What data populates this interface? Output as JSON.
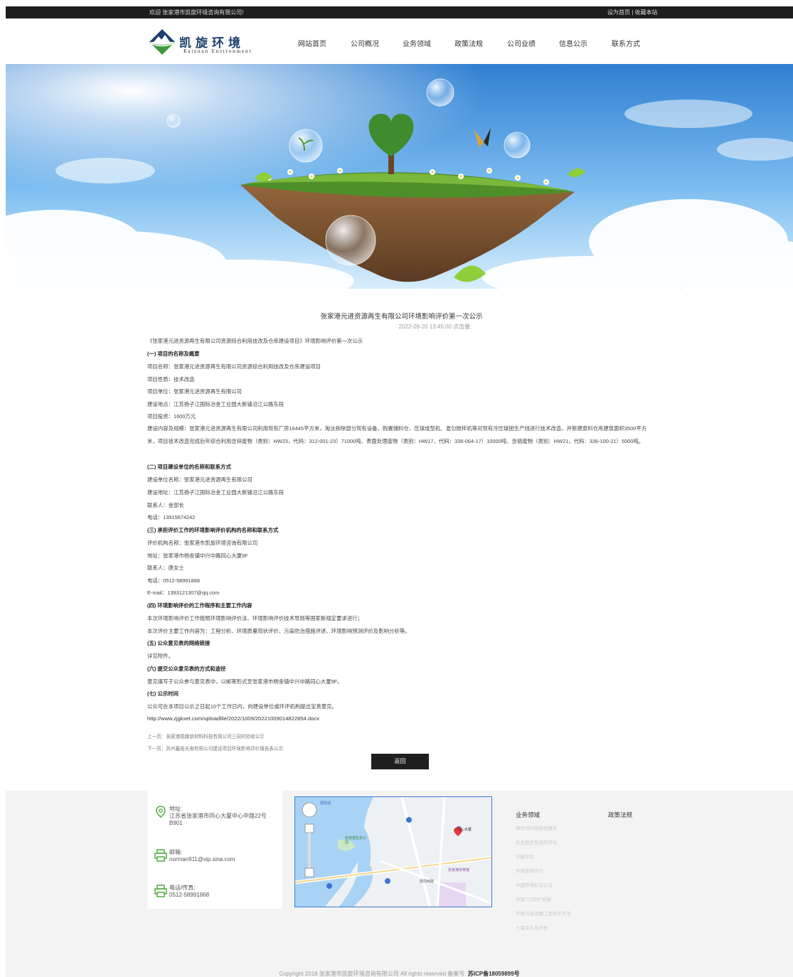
{
  "topbar": {
    "welcome": "欢迎 张家港市凯旋环境咨询有限公司!",
    "set_home": "设为首页",
    "separator": "|",
    "bookmark": "收藏本站"
  },
  "logo": {
    "name_cn": "凯旋环境",
    "name_en": "Kaixuan Environment"
  },
  "nav": [
    "网站首页",
    "公司概况",
    "业务领域",
    "政策法规",
    "公司业绩",
    "信息公示",
    "联系方式"
  ],
  "article": {
    "title": "张家港元进资源再生有限公司环境影响评价第一次公示",
    "meta": "2022-09-20 13:45:00 点击量:",
    "intro": "《张家港元进资源再生有限公司资源综合利用技改及仓库建设项目》环境影响评价第一次公示",
    "h1": "(一) 项目的名称及概要",
    "p_name": "项目名称：张家港元进资源再生有限公司资源综合利用技改及仓库建设项目",
    "p_nature": "项目性质：技术改造",
    "p_unit": "项目单位：张家港元进资源再生有限公司",
    "p_site": "建设地点：江苏扬子江国际冶金工业园大新镇沿江公路东段",
    "p_invest": "项目投资：1600万元",
    "p_scale": "建设内容及规模：张家港元进资源再生有限公司利用现有厂房16445平方米，淘汰拆除部分现有设备，购置储料仓、压球成型机、混匀搅拌机等对现有冷压球团生产线进行技术改造，并新建原料仓库建筑面积3500平方米，项目技术改造完成后年综合利用含锌废物（类别：HW23，代码：312-001-23）71000吨、表面处理废物（类别：HW17，代码：336-064-17）10000吨、含铬废物（类别：HW21，代码：336-100-21）5000吨。",
    "h2": "(二) 项目建设单位的名称和联系方式",
    "b_name": "建设单位名称：张家港元进资源再生有限公司",
    "b_addr": "建设地址：江苏扬子江国际冶金工业园大新镇沿江公路东段",
    "b_contact": "联系人：金部长",
    "b_tel": "电话：13915674242",
    "h3": "(三) 承担评价工作的环境影响评价机构的名称和联系方式",
    "e_name": "评价机构名称：张家港市凯旋环境咨询有限公司",
    "e_addr": "地址：张家港市杨舍镇中兴中路同心大厦9F",
    "e_contact": "联系人：唐女士",
    "e_tel": "电话：0512-58991868",
    "e_mail": "E-mail：1393121307@qq.com",
    "h4": "(四) 环境影响评价的工作程序和主要工作内容",
    "w1": "本次环境影响评价工作按照环境影响评价法、环境影响评价技术导则等国家新规定要求进行；",
    "w2": "本次评价主要工作内容为：工程分析、环境质量现状评价、污染防治措施评述、环境影响预测评价及影响分析等。",
    "h5": "(五) 公众意见表的网络链接",
    "link_text": "详见附件。",
    "h6": "(六) 提交公众意见表的方式和途径",
    "way": "意见填写于公众参与意见表中，以邮寄形式至张家港市杨舍镇中兴中路同心大厦9F。",
    "h7": "(七) 公示时间",
    "time": "公众可在本项目公示之日起10个工作日内，向建设单位或环评机构提出宝贵意见。",
    "url": "http://www.zjgkxet.com/uploadfile/2022/1009/20221009014822854.docx",
    "prev": "上一页：张家港德康新材料科技有限公司三同时验收公示",
    "next": "下一页：苏州鑫裕光电有限公司建设项目环境影响评价报告表公示",
    "back": "返回"
  },
  "footer": {
    "address_label": "地址:",
    "address_value": "江苏省张家港市同心大厦中心中路22号B901",
    "mail_label": "邮箱:",
    "mail_value": "norman911@vip.sina.com",
    "tel_label": "电话/传真:",
    "tel_value": "0512-58991868",
    "business": {
      "heading": "业务领域",
      "items": [
        "项目可行性研究报告",
        "社会稳定性风险评估",
        "节能评估",
        "环境影响评价",
        "中国环境标志认证",
        "环保“三同时”验收",
        "环境污染治理工程技术开发",
        "土壤及生态修复"
      ]
    },
    "policy": {
      "heading": "政策法规"
    },
    "map_labels": {
      "place1": "同心大厦",
      "place2": "张家港生态公园",
      "place3": "张家港体育馆",
      "road": "暨阳湖",
      "road2": "暨阳西路"
    },
    "copyright": "Copyright 2018 张家港市凯旋环境咨询有限公司 All rights reserved 备案号:",
    "icp": "苏ICP备18059899号"
  },
  "colors": {
    "topbar": "#1d1d1d",
    "logo_blue": "#1d3f6e",
    "logo_green": "#3c9a3c",
    "button": "#1f1f1f",
    "footer_bg": "#f3f3f3",
    "map_border": "#3c7bd4"
  }
}
